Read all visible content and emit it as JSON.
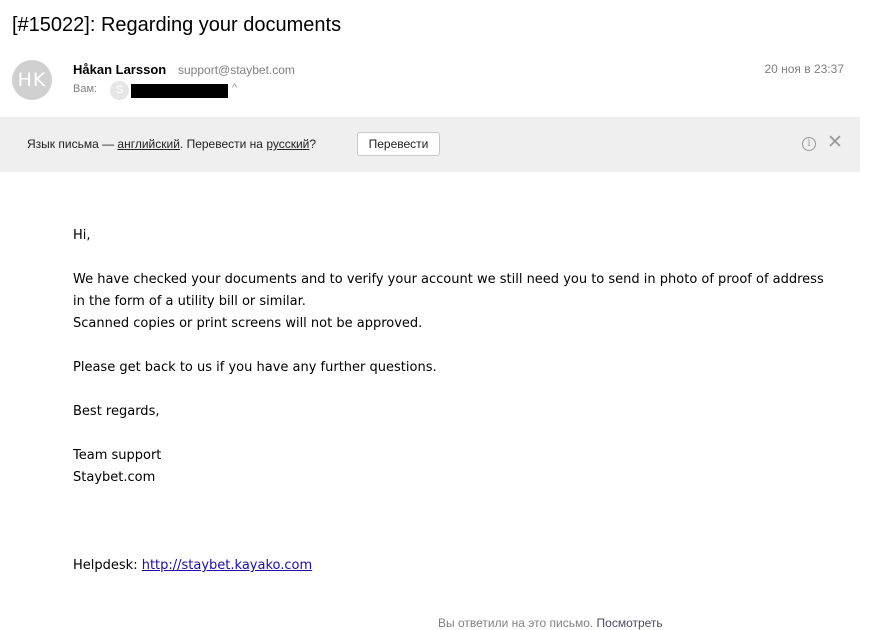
{
  "subject": "[#15022]: Regarding your documents",
  "sender": {
    "avatar_initials": "HK",
    "name": "Håkan Larsson",
    "email": "support@staybet.com",
    "date": "20 ноя в 23:37",
    "to_label": "Вам:",
    "to_avatar_initial": "S"
  },
  "translate_bar": {
    "prefix": "Язык письма — ",
    "source_language": "английский",
    "middle": ". Перевести на ",
    "target_language": "русский",
    "suffix": "?",
    "button_label": "Перевести",
    "info_icon": "i",
    "close_icon": "✕"
  },
  "message": {
    "greeting": "Hi,",
    "paragraph1_line1": "We have checked your documents and to verify your account we still need you to send in photo of proof of address",
    "paragraph1_line2": "in the form of a utility bill or similar.",
    "paragraph1_line3": "Scanned copies or print screens will not be approved.",
    "paragraph2": "Please get back to us if you have any further questions.",
    "closing": "Best regards,",
    "signature_line1": "Team support",
    "signature_line2": "Staybet.com",
    "helpdesk_label": "Helpdesk: ",
    "helpdesk_url": "http://staybet.kayako.com"
  },
  "footer": {
    "text": "Вы ответили на это письмо. ",
    "link": "Посмотреть"
  }
}
